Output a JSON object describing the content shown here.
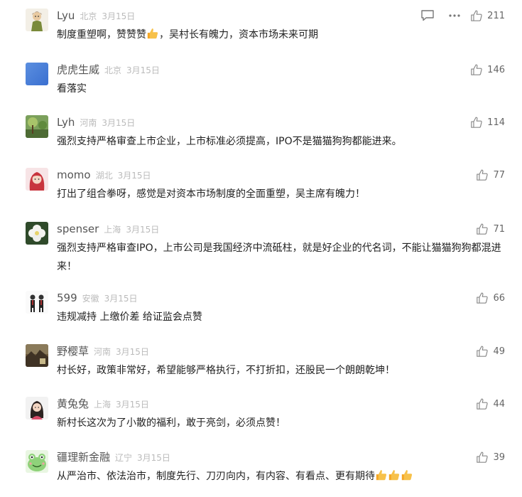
{
  "comments": [
    {
      "name": "Lyu",
      "location": "北京",
      "date": "3月15日",
      "text": "制度重塑啊，赞赞赞",
      "text_after": "，吴村长有魄力，资本市场未来可期",
      "emoji_count": 1,
      "likes": "211",
      "avatar_icon": "avatar-cartoon-icon",
      "has_tools": true
    },
    {
      "name": "虎虎生威",
      "location": "北京",
      "date": "3月15日",
      "text": "看落实",
      "likes": "146",
      "avatar_icon": "avatar-blue-icon"
    },
    {
      "name": "Lyh",
      "location": "河南",
      "date": "3月15日",
      "text": "强烈支持严格审查上市企业，上市标准必须提高，IPO不是猫猫狗狗都能进来。",
      "likes": "114",
      "avatar_icon": "avatar-nature-icon"
    },
    {
      "name": "momo",
      "location": "湖北",
      "date": "3月15日",
      "text": "打出了组合拳呀，感觉是对资本市场制度的全面重塑，吴主席有魄力！",
      "likes": "77",
      "avatar_icon": "avatar-girl-icon"
    },
    {
      "name": "spenser",
      "location": "上海",
      "date": "3月15日",
      "text": "强烈支持严格审查IPO，上市公司是我国经济中流砥柱，就是好企业的代名词，不能让猫猫狗狗都混进来！",
      "likes": "71",
      "avatar_icon": "avatar-flower-icon"
    },
    {
      "name": "599",
      "location": "安徽",
      "date": "3月15日",
      "text": "违规减持 上缴价差 给证监会点赞",
      "likes": "66",
      "avatar_icon": "avatar-people-icon"
    },
    {
      "name": "野樱草",
      "location": "河南",
      "date": "3月15日",
      "text": "村长好，政策非常好，希望能够严格执行，不打折扣，还股民一个朗朗乾坤！",
      "likes": "49",
      "avatar_icon": "avatar-landscape-icon"
    },
    {
      "name": "黄兔兔",
      "location": "上海",
      "date": "3月15日",
      "text": "新村长这次为了小散的福利，敢于亮剑，必须点赞！",
      "likes": "44",
      "avatar_icon": "avatar-woman-icon"
    },
    {
      "name": "疆理新金融",
      "location": "辽宁",
      "date": "3月15日",
      "text": "从严治市、依法治市，制度先行、刀刃向内，有内容、有看点、更有期待",
      "text_after": "",
      "emoji_count": 3,
      "likes": "39",
      "avatar_icon": "avatar-frog-icon"
    }
  ],
  "colors": {
    "name": "#555555",
    "meta": "#bbbbbb",
    "text": "#222222",
    "icon": "#888888"
  }
}
